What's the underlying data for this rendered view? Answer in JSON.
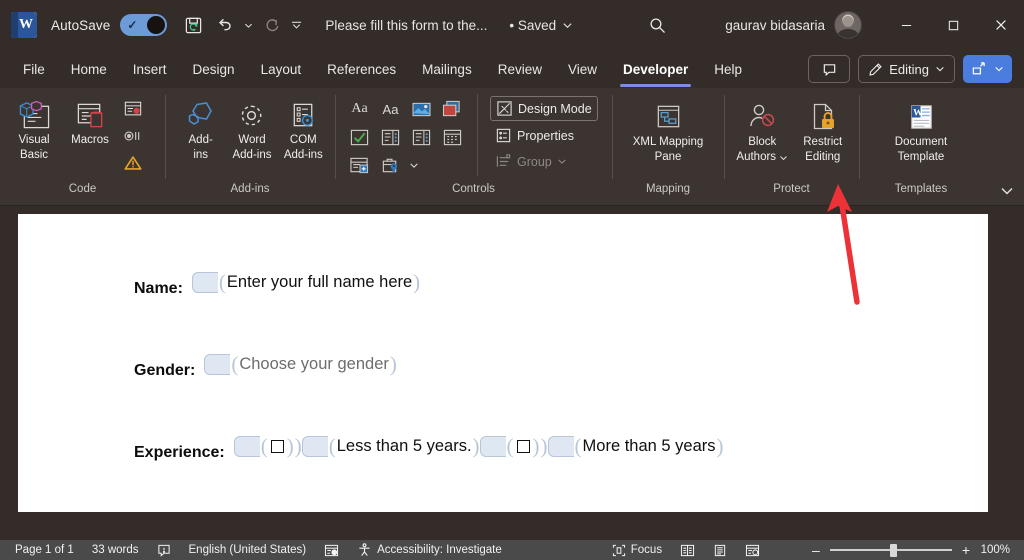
{
  "titlebar": {
    "app_logo": "word-logo",
    "autosave_label": "AutoSave",
    "autosave_on": "On",
    "doc_title": "Please fill this form to the...",
    "save_state": "• Saved",
    "search_icon": "search-icon",
    "account_name": "gaurav bidasaria",
    "minimize": "–",
    "maximize": "□",
    "close": "✕"
  },
  "tabs": [
    {
      "label": "File",
      "active": false
    },
    {
      "label": "Home",
      "active": false
    },
    {
      "label": "Insert",
      "active": false
    },
    {
      "label": "Design",
      "active": false
    },
    {
      "label": "Layout",
      "active": false
    },
    {
      "label": "References",
      "active": false
    },
    {
      "label": "Mailings",
      "active": false
    },
    {
      "label": "Review",
      "active": false
    },
    {
      "label": "View",
      "active": false
    },
    {
      "label": "Developer",
      "active": true
    },
    {
      "label": "Help",
      "active": false
    }
  ],
  "tabbar_right": {
    "comments_label": "",
    "editing_label": "Editing",
    "share_label": ""
  },
  "ribbon": {
    "groups": [
      {
        "name": "Code",
        "label": "Code",
        "buttons": [
          {
            "label": "Visual Basic",
            "line1": "Visual",
            "line2": "Basic",
            "icon": "visual-basic-icon"
          },
          {
            "label": "Macros",
            "line1": "Macros",
            "line2": "",
            "icon": "macros-icon"
          }
        ],
        "small_buttons": [
          {
            "label": "",
            "icon": "record-macro-icon"
          },
          {
            "label": "",
            "icon": "pause-recording-icon"
          },
          {
            "label": "",
            "icon": "macro-security-icon"
          }
        ]
      },
      {
        "name": "Add-ins",
        "label": "Add-ins",
        "buttons": [
          {
            "label": "Add-ins",
            "line1": "Add-",
            "line2": "ins",
            "icon": "add-ins-icon"
          },
          {
            "label": "Word Add-ins",
            "line1": "Word",
            "line2": "Add-ins",
            "icon": "word-add-ins-icon"
          },
          {
            "label": "COM Add-ins",
            "line1": "COM",
            "line2": "Add-ins",
            "icon": "com-add-ins-icon"
          }
        ]
      },
      {
        "name": "Controls",
        "label": "Controls",
        "grid": [
          [
            "rich-text-content-control-icon",
            "plain-text-content-control-icon",
            "picture-content-control-icon",
            "building-block-gallery-icon"
          ],
          [
            "check-box-content-control-icon",
            "combo-box-content-control-icon",
            "drop-down-list-content-control-icon",
            "date-picker-content-control-icon"
          ],
          [
            "repeating-section-content-control-icon",
            "legacy-tools-icon",
            "legacy-tools-chevron-icon"
          ]
        ],
        "items": [
          {
            "label": "Design Mode",
            "icon": "design-mode-icon",
            "disabled": false,
            "boxed": true
          },
          {
            "label": "Properties",
            "icon": "properties-icon",
            "disabled": false,
            "boxed": false
          },
          {
            "label": "Group",
            "icon": "group-icon",
            "disabled": true,
            "boxed": false
          }
        ]
      },
      {
        "name": "Mapping",
        "label": "Mapping",
        "buttons": [
          {
            "label": "XML Mapping Pane",
            "line1": "XML Mapping",
            "line2": "Pane",
            "icon": "xml-mapping-pane-icon"
          }
        ]
      },
      {
        "name": "Protect",
        "label": "Protect",
        "buttons": [
          {
            "label": "Block Authors",
            "line1": "Block",
            "line2": "Authors",
            "icon": "block-authors-icon",
            "has_chevron": true
          },
          {
            "label": "Restrict Editing",
            "line1": "Restrict",
            "line2": "Editing",
            "icon": "restrict-editing-icon"
          }
        ]
      },
      {
        "name": "Templates",
        "label": "Templates",
        "buttons": [
          {
            "label": "Document Template",
            "line1": "Document",
            "line2": "Template",
            "icon": "document-template-icon"
          }
        ]
      }
    ],
    "collapse_icon": "chevron-down-icon"
  },
  "document": {
    "rows": [
      {
        "label": "Name:",
        "controls": [
          {
            "text": "Enter your full name here",
            "placeholder": false,
            "has_tag": true,
            "checkbox": false
          }
        ]
      },
      {
        "label": "Gender:",
        "controls": [
          {
            "text": "Choose your gender",
            "placeholder": true,
            "has_tag": true,
            "checkbox": false
          }
        ]
      },
      {
        "label": "Experience:",
        "controls": [
          {
            "text": "",
            "placeholder": false,
            "has_tag": true,
            "checkbox": true
          },
          {
            "text": "Less than 5 years.",
            "placeholder": false,
            "has_tag": true,
            "checkbox": false
          },
          {
            "text": "",
            "placeholder": false,
            "has_tag": true,
            "checkbox": true
          },
          {
            "text": "More than 5 years",
            "placeholder": false,
            "has_tag": true,
            "checkbox": false
          }
        ]
      }
    ]
  },
  "annotation": {
    "type": "red-arrow",
    "color": "#ec3237",
    "points_to": "Restrict Editing"
  },
  "statusbar": {
    "page": "Page 1 of 1",
    "words": "33 words",
    "proofing_icon": "proofing-errors-icon",
    "language": "English (United States)",
    "dictate_icon": "dictate-icon",
    "accessibility": "Accessibility: Investigate",
    "focus": "Focus",
    "view_read_icon": "read-mode-icon",
    "view_print_icon": "print-layout-icon",
    "view_web_icon": "web-layout-icon",
    "zoom_out": "–",
    "zoom_in": "+",
    "zoom_level": "100%"
  }
}
